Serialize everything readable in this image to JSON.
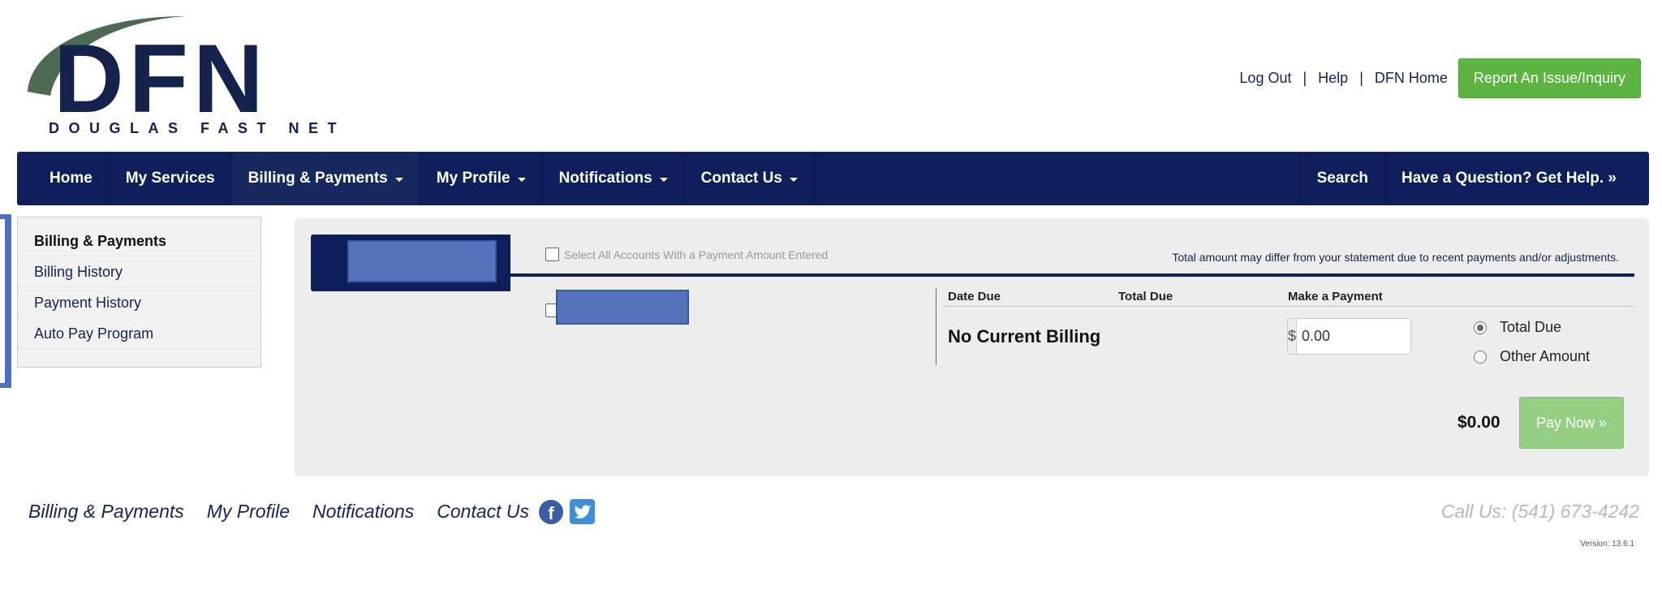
{
  "brand": {
    "logo_letters": "DFN",
    "tagline": "DOUGLAS FAST NET",
    "color_primary": "#14224c",
    "color_swoosh": "#4d6b52"
  },
  "header": {
    "links": [
      "Log Out",
      "Help",
      "DFN Home"
    ],
    "report_button": "Report An Issue/Inquiry",
    "report_color": "#5cb542"
  },
  "nav": {
    "items": [
      "Home",
      "My Services",
      "Billing & Payments",
      "My Profile",
      "Notifications",
      "Contact Us"
    ],
    "right_items": [
      "Search",
      "Have a Question? Get Help. »"
    ],
    "bg_color": "#0e1f5b"
  },
  "sidebar": {
    "header": "Billing & Payments",
    "items": [
      "Billing History",
      "Payment History",
      "Auto Pay Program"
    ]
  },
  "billing": {
    "select_all_label": "Select All Accounts With a Payment Amount Entered",
    "disclaimer": "Total amount may differ from your statement due to recent payments and/or adjustments.",
    "columns": {
      "date_due": "Date Due",
      "total_due": "Total Due",
      "make_payment": "Make a Payment"
    },
    "status": "No Current Billing",
    "currency_symbol": "$",
    "amount_value": "0.00",
    "radio_total_due": "Total Due",
    "radio_other_amount": "Other Amount",
    "total_amount": "$0.00",
    "pay_button": "Pay Now »"
  },
  "footer": {
    "links": [
      "Billing & Payments",
      "My Profile",
      "Notifications",
      "Contact Us"
    ],
    "call_us": "Call Us: (541) 673-4242",
    "version": "Version: 13.6.1"
  }
}
